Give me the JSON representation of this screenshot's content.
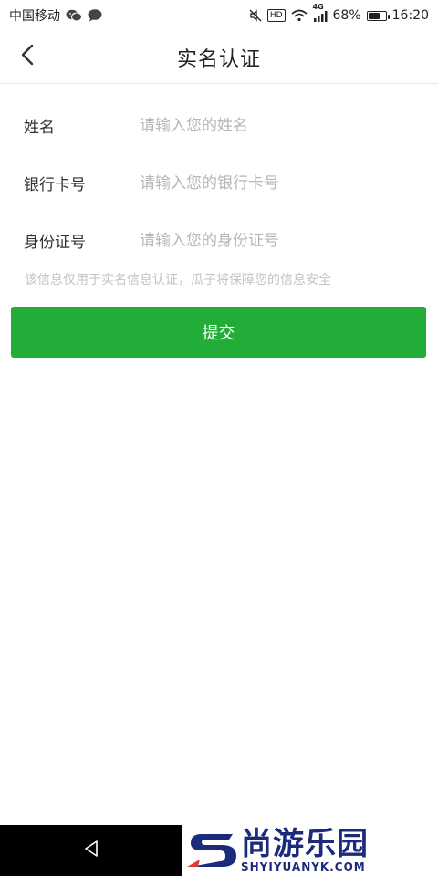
{
  "status_bar": {
    "carrier": "中国移动",
    "network": "4G",
    "hd_badge": "HD",
    "battery_percent": "68%",
    "battery_level": 0.68,
    "time": "16:20",
    "icons": [
      "wechat-icon",
      "message-bubble-icon",
      "mute-icon",
      "hd-icon",
      "wifi-icon",
      "signal-icon",
      "battery-icon"
    ]
  },
  "header": {
    "title": "实名认证",
    "back_icon": "chevron-left-icon"
  },
  "form": {
    "fields": [
      {
        "label": "姓名",
        "placeholder": "请输入您的姓名",
        "value": ""
      },
      {
        "label": "银行卡号",
        "placeholder": "请输入您的银行卡号",
        "value": ""
      },
      {
        "label": "身份证号",
        "placeholder": "请输入您的身份证号",
        "value": ""
      }
    ],
    "notice": "该信息仅用于实名信息认证，瓜子将保障您的信息安全"
  },
  "submit": {
    "label": "提交",
    "color": "#22ac38"
  },
  "nav_bar": {
    "back_icon": "triangle-back-icon"
  },
  "watermark": {
    "cn": "尚游乐园",
    "en": "SHYIYUANYK.COM"
  }
}
